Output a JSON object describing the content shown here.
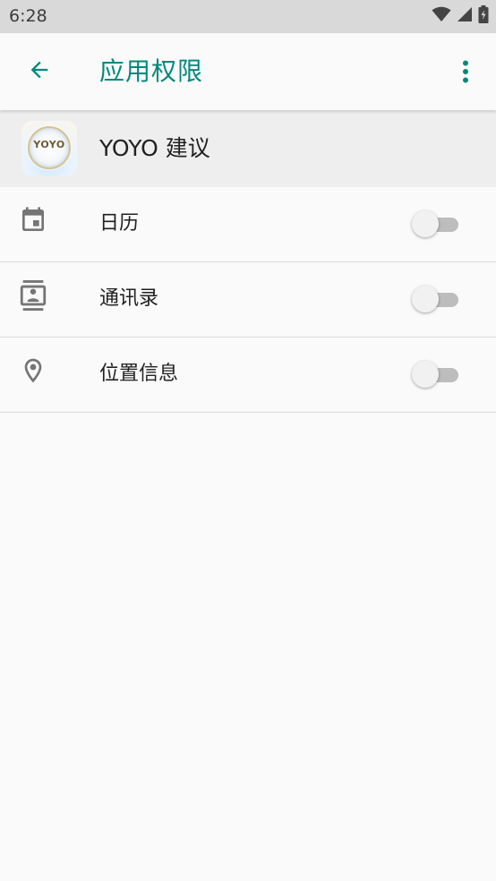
{
  "status_bar": {
    "time": "6:28",
    "icons": [
      "wifi-icon",
      "cell-signal-icon",
      "battery-charging-icon"
    ]
  },
  "app_bar": {
    "title": "应用权限",
    "back_icon": "arrow-back-icon",
    "menu_icon": "more-vert-icon"
  },
  "app": {
    "name": "YOYO 建议",
    "icon_text": "YOYO"
  },
  "permissions": [
    {
      "label": "日历",
      "icon": "calendar-icon",
      "enabled": false
    },
    {
      "label": "通讯录",
      "icon": "contacts-icon",
      "enabled": false
    },
    {
      "label": "位置信息",
      "icon": "location-icon",
      "enabled": false
    }
  ],
  "colors": {
    "accent": "#00897b",
    "status_bar": "#d9d9d9",
    "background": "#fafafa",
    "header_bg": "#eeeeee",
    "icon_gray": "#757575"
  }
}
